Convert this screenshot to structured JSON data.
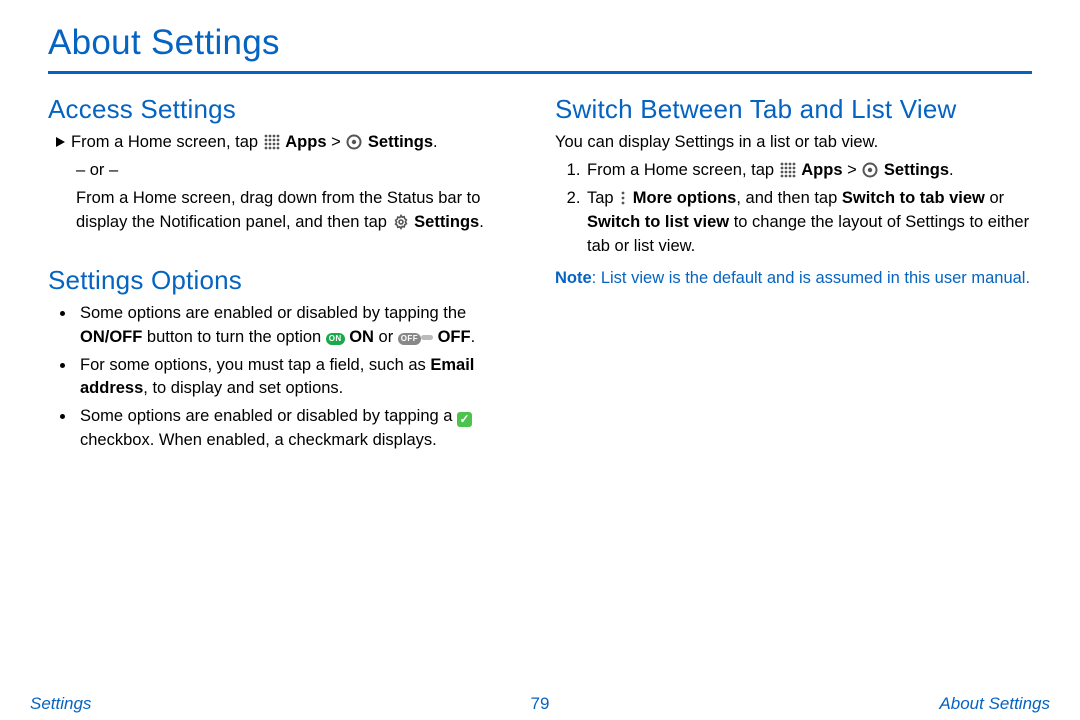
{
  "page_title": "About Settings",
  "footer": {
    "left": "Settings",
    "center": "79",
    "right": "About Settings"
  },
  "left": {
    "access": {
      "title": "Access Settings",
      "line1_pre": "From a Home screen, tap ",
      "apps_bold": "Apps",
      "sep": " > ",
      "settings_bold": "Settings",
      "period": ".",
      "or_line": "– or –",
      "alt_pre": "From a Home screen, drag down from the Status bar to display the Notification panel, and then tap ",
      "alt_settings_bold": "Settings",
      "alt_period": "."
    },
    "options": {
      "title": "Settings Options",
      "b1_pre": "Some options are enabled or disabled by tapping the ",
      "b1_onoff": "ON/OFF",
      "b1_mid": " button to turn the option ",
      "b1_on_bold": " ON",
      "b1_or": " or ",
      "b1_off_bold": " OFF",
      "b1_post": ".",
      "b2_pre": "For some options, you must tap a field, such as ",
      "b2_email": "Email address",
      "b2_post": ", to display and set options.",
      "b3_pre": "Some options are enabled or disabled by tapping a ",
      "b3_post": " checkbox. When enabled, a checkmark displays."
    }
  },
  "right": {
    "switch": {
      "title": "Switch Between Tab and List View",
      "intro": "You can display Settings in a list or tab view.",
      "s1_pre": "From a Home screen, tap ",
      "s1_apps_bold": "Apps",
      "s1_sep": " > ",
      "s1_settings_bold": "Settings",
      "s1_post": ".",
      "s2_pre": "Tap ",
      "s2_more_bold": "More options",
      "s2_mid1": ", and then tap ",
      "s2_tab_bold": "Switch to tab view",
      "s2_or": " or ",
      "s2_list_bold": "Switch to list view",
      "s2_post": " to change the layout of Settings to either tab or list view.",
      "note_label": "Note",
      "note_text": ": List view is the default and is assumed in this user manual."
    }
  },
  "icon_labels": {
    "on": "ON",
    "off": "OFF"
  }
}
